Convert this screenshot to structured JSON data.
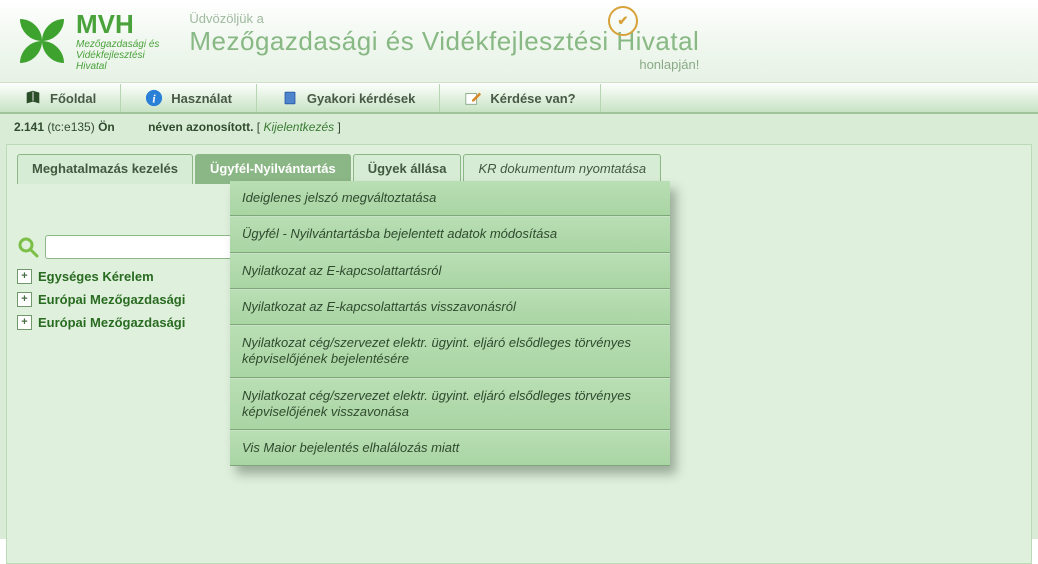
{
  "header": {
    "brand_short": "MVH",
    "brand_line1": "Mezőgazdasági és",
    "brand_line2": "Vidékfejlesztési",
    "brand_line3": "Hivatal",
    "welcome_line1": "Üdvözöljük a",
    "welcome_line2": "Mezőgazdasági és Vidékfejlesztési Hivatal",
    "welcome_line3": "honlapján!"
  },
  "toolbar": {
    "home": "Főoldal",
    "usage": "Használat",
    "faq": "Gyakori kérdések",
    "question": "Kérdése van?"
  },
  "status": {
    "version": "2.141",
    "build": "(tc:e135)",
    "you": "Ön",
    "identified": "néven azonosított.",
    "bracket_open": "[ ",
    "logout": "Kijelentkezés",
    "bracket_close": " ]"
  },
  "tabs": {
    "t1": "Meghatalmazás kezelés",
    "t2": "Ügyfél-Nyilvántartás",
    "t3": "Ügyek állása",
    "t4": "KR dokumentum nyomtatása"
  },
  "menu": {
    "m1": "Ideiglenes jelszó megváltoztatása",
    "m2": "Ügyfél - Nyilvántartásba bejelentett adatok módosítása",
    "m3": "Nyilatkozat az E-kapcsolattartásról",
    "m4": "Nyilatkozat az E-kapcsolattartás visszavonásról",
    "m5": "Nyilatkozat cég/szervezet elektr. ügyint. eljáró elsődleges törvényes képviselőjének bejelentésére",
    "m6": "Nyilatkozat cég/szervezet elektr. ügyint. eljáró elsődleges törvényes képviselőjének visszavonása",
    "m7": "Vis Maior bejelentés elhalálozás miatt"
  },
  "search": {
    "value": "",
    "placeholder": ""
  },
  "tree": {
    "n1": "Egységes Kérelem",
    "n2": "Európai Mezőgazdasági",
    "n3": "Európai Mezőgazdasági"
  }
}
